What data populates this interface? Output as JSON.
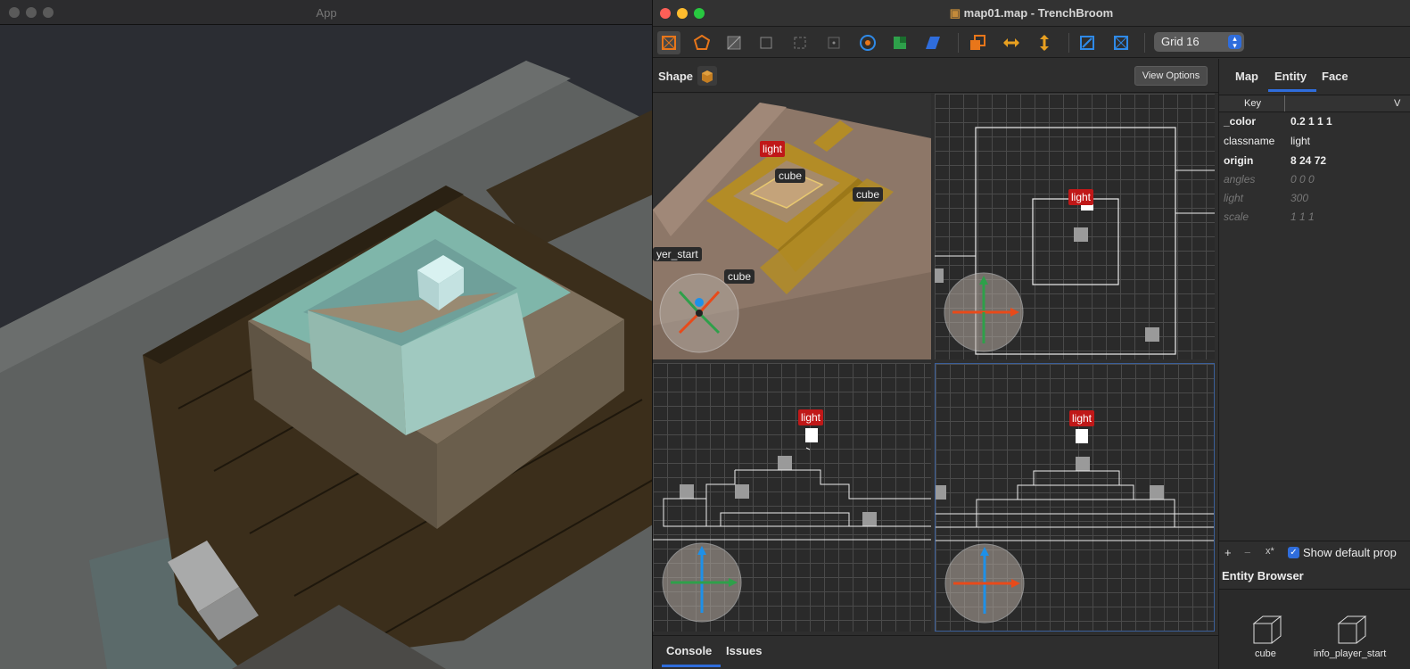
{
  "app_window": {
    "title": "App"
  },
  "trenchbroom": {
    "title": "map01.map - TrenchBroom",
    "grid_select": "Grid 16",
    "shape_label": "Shape",
    "view_options": "View Options",
    "viewport_3d_labels": [
      "light",
      "cube",
      "cube",
      "cube",
      "yer_start"
    ],
    "viewport_top_label": "light",
    "viewport_front_label": "light",
    "viewport_side_label": "light",
    "console_tabs": [
      "Console",
      "Issues"
    ],
    "inspector": {
      "tabs": [
        "Map",
        "Entity",
        "Face"
      ],
      "column_key": "Key",
      "column_value": "V",
      "properties": [
        {
          "key": "_color",
          "value": "0.2 1 1 1"
        },
        {
          "key": "classname",
          "value": "light"
        },
        {
          "key": "origin",
          "value": "8 24 72"
        }
      ],
      "default_properties": [
        {
          "key": "angles",
          "value": "0 0 0"
        },
        {
          "key": "light",
          "value": "300"
        },
        {
          "key": "scale",
          "value": "1 1 1"
        }
      ],
      "footer_buttons": [
        "+",
        "−",
        "x*"
      ],
      "show_default_label": "Show default prop",
      "entity_browser_title": "Entity Browser",
      "entities": [
        "cube",
        "info_player_start"
      ]
    }
  },
  "colors": {
    "accent": "#2f6ddc",
    "light_tag": "#c01818",
    "selection": "#e8a020"
  }
}
